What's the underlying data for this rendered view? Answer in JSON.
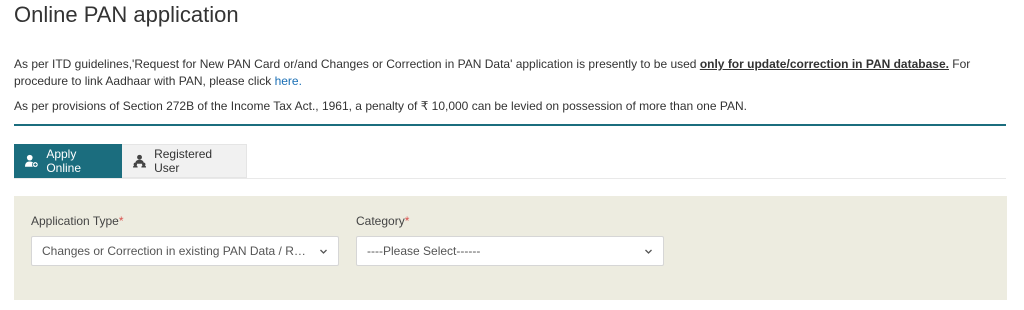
{
  "page": {
    "title": "Online PAN application"
  },
  "notices": {
    "line1_prefix": "As per ITD guidelines,'Request for New PAN Card or/and Changes or Correction in PAN Data' application is presently to be used ",
    "line1_bold": "only for update/correction in PAN database.",
    "line1_suffix": " For procedure to link Aadhaar with PAN, please click ",
    "line1_link": "here.",
    "line2": "As per provisions of Section 272B of the Income Tax Act., 1961, a penalty of ₹ 10,000 can be levied on possession of more than one PAN."
  },
  "tabs": [
    {
      "label": "Apply Online",
      "icon": "user-add-icon",
      "active": true
    },
    {
      "label": "Registered User",
      "icon": "user-group-icon",
      "active": false
    }
  ],
  "form": {
    "application_type": {
      "label": "Application Type",
      "required_marker": "*",
      "value": "Changes or Correction in existing PAN Data / Reprint of PAN Card (No changes in Existing PAN Data)"
    },
    "category": {
      "label": "Category",
      "required_marker": "*",
      "value": "----Please Select------"
    }
  },
  "colors": {
    "accent": "#1b6d7e",
    "panel_bg": "#edece0",
    "required": "#d9534f",
    "link": "#1a6fb5"
  }
}
